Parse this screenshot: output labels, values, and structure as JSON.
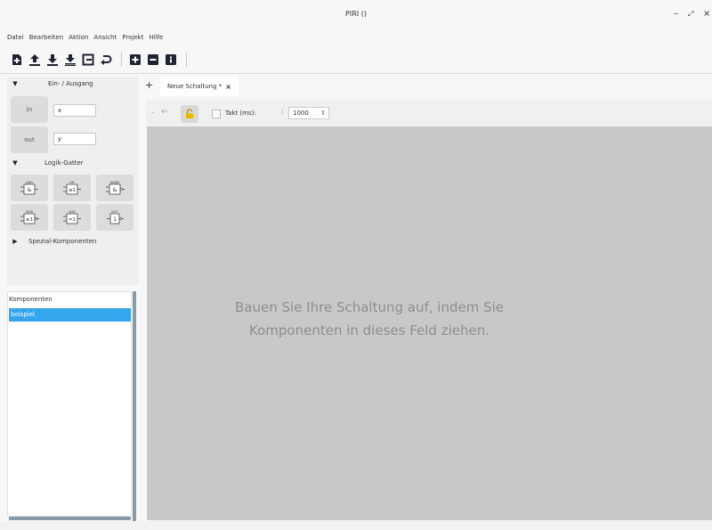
{
  "window": {
    "title": "PIRI ()",
    "minimize": "–",
    "maximize": "⤢",
    "close": "×"
  },
  "menu": [
    "Datei",
    "Bearbeiten",
    "Aktion",
    "Ansicht",
    "Projekt",
    "Hilfe"
  ],
  "toolbar": {
    "icons": [
      "new-file-icon",
      "upload-icon",
      "download-icon",
      "download-all-icon",
      "export-icon",
      "undo-icon",
      "add-box-icon",
      "remove-box-icon",
      "info-box-icon"
    ]
  },
  "palette": {
    "io_section": "Ein- / Ausgang",
    "in_button": "in",
    "in_value": "x",
    "out_button": "out",
    "out_value": "y",
    "logic_section": "Logik-Gatter",
    "gates": [
      {
        "name": "AND",
        "symbol": "&"
      },
      {
        "name": "OR",
        "symbol": "≥1"
      },
      {
        "name": "NAND",
        "symbol": "&"
      },
      {
        "name": "NOR",
        "symbol": "≥1"
      },
      {
        "name": "XOR",
        "symbol": "=1"
      },
      {
        "name": "NOT",
        "symbol": "1"
      }
    ],
    "special_section": "Spezial-Komponenten"
  },
  "components": {
    "header": "Komponenten",
    "items": [
      "beispiel"
    ]
  },
  "tabs": {
    "new_label": "+",
    "active_label": "Neue Schaltung *",
    "close": "×"
  },
  "editor_toolbar": {
    "back": "←",
    "takt_label": "Takt (ms):",
    "takt_value": "1000",
    "takt_checked": false
  },
  "canvas": {
    "hint_line1": "Bauen Sie Ihre Schaltung auf, indem Sie",
    "hint_line2": "Komponenten in dieses Feld ziehen."
  },
  "colors": {
    "selection": "#35a6ee",
    "canvas": "#c8c8c8",
    "lock_icon": "#e8b800"
  }
}
